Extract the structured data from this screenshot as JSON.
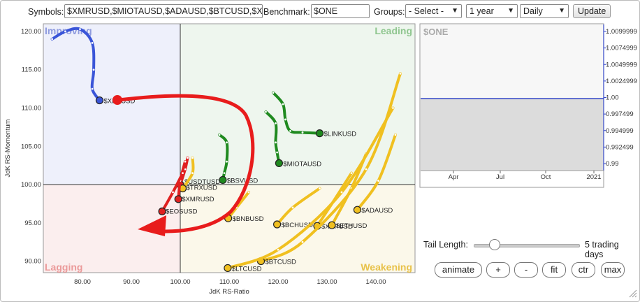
{
  "toolbar": {
    "symbols_label": "Symbols:",
    "symbols_value": "$XMRUSD,$MIOTAUSD,$ADAUSD,$BTCUSD,$XF",
    "benchmark_label": "Benchmark:",
    "benchmark_value": "$ONE",
    "groups_label": "Groups:",
    "groups_value": "- Select -",
    "period_value": "1 year",
    "interval_value": "Daily",
    "update_label": "Update"
  },
  "rrg": {
    "quadrants": {
      "improving": "Improving",
      "leading": "Leading",
      "lagging": "Lagging",
      "weakening": "Weakening"
    },
    "xlabel": "JdK RS-Ratio",
    "ylabel": "JdK RS-Momentum",
    "x_ticks": [
      "80.00",
      "90.00",
      "100.00",
      "110.00",
      "120.00",
      "130.00",
      "140.00"
    ],
    "y_ticks": [
      "120.00",
      "115.00",
      "110.00",
      "105.00",
      "100.00",
      "95.00",
      "90.00"
    ],
    "labels": [
      "$XLMUSD",
      "$LINKUSD",
      "$MIOTAUSD",
      "$BSVUSD",
      "$USDTUSD",
      "$TRXUSD",
      "$XMRUSD",
      "$EOSUSD",
      "$BNBUSD",
      "$BCHUSD",
      "$XRPUSD",
      "$ETHUSD",
      "$ADAUSD",
      "$BTCUSD",
      "$LTCUSD"
    ],
    "colors": {
      "improving": "#3a55d8",
      "leading": "#1f8a1f",
      "lagging": "#e02020",
      "weakening": "#f0c020",
      "annotation": "#e81c1c"
    }
  },
  "chart_data": {
    "type": "scatter",
    "title": "",
    "xlabel": "JdK RS-Ratio",
    "ylabel": "JdK RS-Momentum",
    "xlim": [
      72,
      148
    ],
    "ylim": [
      88.5,
      121
    ],
    "series": [
      {
        "name": "$XLMUSD",
        "quadrant": "improving",
        "points": [
          [
            73.8,
            119.0
          ],
          [
            76.5,
            120.0
          ],
          [
            79.5,
            120.3
          ],
          [
            82.0,
            118.5
          ],
          [
            82.3,
            115.0
          ],
          [
            82.0,
            112.5
          ],
          [
            83.5,
            111.0
          ]
        ]
      },
      {
        "name": "$LINKUSD",
        "quadrant": "leading",
        "points": [
          [
            119.0,
            112.0
          ],
          [
            121.0,
            110.5
          ],
          [
            121.5,
            108.5
          ],
          [
            122.5,
            107.0
          ],
          [
            125.0,
            106.8
          ],
          [
            128.5,
            106.7
          ]
        ]
      },
      {
        "name": "$MIOTAUSD",
        "quadrant": "leading",
        "points": [
          [
            117.5,
            109.5
          ],
          [
            119.5,
            108.0
          ],
          [
            119.5,
            105.5
          ],
          [
            119.8,
            104.2
          ],
          [
            120.2,
            102.8
          ]
        ]
      },
      {
        "name": "$BSVUSD",
        "quadrant": "leading",
        "points": [
          [
            108.0,
            106.5
          ],
          [
            109.5,
            105.5
          ],
          [
            109.5,
            103.0
          ],
          [
            109.0,
            101.5
          ],
          [
            108.7,
            100.6
          ]
        ]
      },
      {
        "name": "$USDTUSD",
        "quadrant": "lagging",
        "points": [
          [
            101.5,
            103.5
          ],
          [
            101.0,
            102.0
          ],
          [
            100.0,
            100.0
          ]
        ]
      },
      {
        "name": "$TRXUSD",
        "quadrant": "weakening",
        "points": [
          [
            102.5,
            103.5
          ],
          [
            102.5,
            101.5
          ],
          [
            100.5,
            99.5
          ]
        ]
      },
      {
        "name": "$XMRUSD",
        "quadrant": "lagging",
        "points": [
          [
            101.0,
            103.0
          ],
          [
            100.0,
            100.5
          ],
          [
            99.6,
            98.1
          ]
        ]
      },
      {
        "name": "$EOSUSD",
        "quadrant": "lagging",
        "points": [
          [
            100.5,
            101.5
          ],
          [
            98.5,
            99.0
          ],
          [
            96.3,
            96.5
          ]
        ]
      },
      {
        "name": "$BNBUSD",
        "quadrant": "weakening",
        "points": [
          [
            114.0,
            99.0
          ],
          [
            111.5,
            97.0
          ],
          [
            109.8,
            95.6
          ]
        ]
      },
      {
        "name": "$BCHUSD",
        "quadrant": "weakening",
        "points": [
          [
            128.5,
            99.5
          ],
          [
            123.0,
            97.0
          ],
          [
            119.8,
            94.8
          ]
        ]
      },
      {
        "name": "$XRPUSD",
        "quadrant": "weakening",
        "points": [
          [
            135.0,
            101.5
          ],
          [
            131.0,
            97.5
          ],
          [
            128.0,
            94.6
          ]
        ]
      },
      {
        "name": "$ETHUSD",
        "quadrant": "weakening",
        "points": [
          [
            138.0,
            104.0
          ],
          [
            135.0,
            99.5
          ],
          [
            131.0,
            94.7
          ]
        ]
      },
      {
        "name": "$ADAUSD",
        "quadrant": "weakening",
        "points": [
          [
            144.0,
            106.5
          ],
          [
            140.5,
            100.5
          ],
          [
            136.2,
            96.7
          ]
        ]
      },
      {
        "name": "$BTCUSD",
        "quadrant": "weakening",
        "points": [
          [
            145.0,
            114.5
          ],
          [
            138.0,
            102.0
          ],
          [
            125.0,
            92.5
          ],
          [
            116.5,
            90.0
          ]
        ]
      },
      {
        "name": "$LTCUSD",
        "quadrant": "weakening",
        "points": [
          [
            143.5,
            110.0
          ],
          [
            133.0,
            99.0
          ],
          [
            120.0,
            91.5
          ],
          [
            109.7,
            89.1
          ]
        ]
      }
    ]
  },
  "benchmark_chart": {
    "title": "$ONE",
    "y_ticks": [
      "1.0099999",
      "1.0074999",
      "1.0049999",
      "1.0024999",
      "1.00",
      "0.997499",
      "0.994999",
      "0.992499",
      "0.99"
    ],
    "x_ticks": [
      "Apr",
      "Jul",
      "Oct",
      "2021"
    ],
    "value": 1.0
  },
  "controls": {
    "tail_label": "Tail Length:",
    "tail_value": "5 trading days",
    "tail_fraction": 0.15,
    "buttons": [
      "animate",
      "+",
      "-",
      "fit",
      "ctr",
      "max"
    ]
  }
}
